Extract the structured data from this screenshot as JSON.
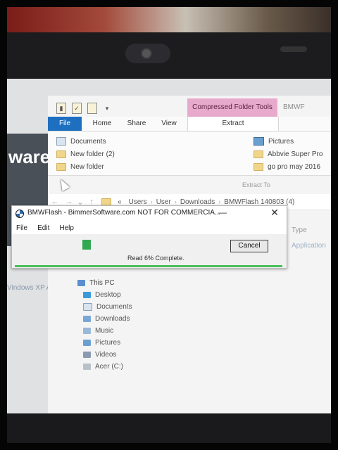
{
  "explorer": {
    "ribbon": {
      "context_tab": "Compressed Folder Tools",
      "title_right": "BMWF",
      "tabs": [
        "File",
        "Home",
        "Share",
        "View",
        "Extract"
      ],
      "left_items": [
        "Documents",
        "New folder (2)",
        "New folder"
      ],
      "right_items": [
        "Pictures",
        "Abbvie Super Pro",
        "go pro may 2016"
      ],
      "extract_to": "Extract To"
    },
    "address": {
      "chevrons": "«",
      "crumbs": [
        "Users",
        "User",
        "Downloads",
        "BMWFlash 140803 (4)"
      ]
    },
    "columns": {
      "type": "Type",
      "type_value": "Application"
    },
    "tree": {
      "root": "This PC",
      "items": [
        "Desktop",
        "Documents",
        "Downloads",
        "Music",
        "Pictures",
        "Videos",
        "Acer (C:)"
      ]
    }
  },
  "background": {
    "web_text": "ware.",
    "web_caption": "Vindows XP A"
  },
  "dialog": {
    "title": "BMWFlash - BimmerSoftware.com NOT FOR COMMERCIA...",
    "min_glyph": "—",
    "close_glyph": "✕",
    "menu": [
      "File",
      "Edit",
      "Help"
    ],
    "progress_percent": 6,
    "status": "Read 6% Complete.",
    "cancel_label": "Cancel"
  },
  "colors": {
    "progress": "#32a852",
    "accent_border": "#4cbf5a",
    "file_tab": "#1f6fc0",
    "context_tab": "#e8aacc"
  }
}
